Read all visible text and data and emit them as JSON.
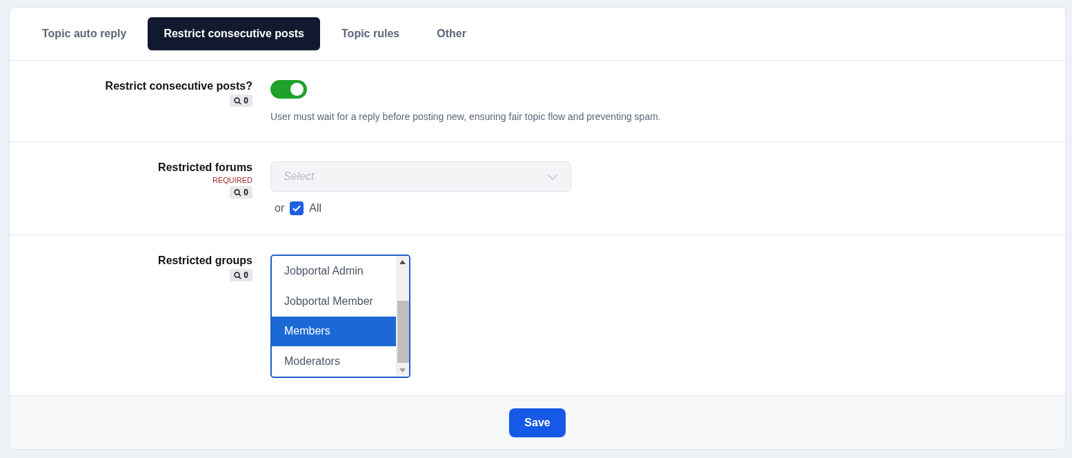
{
  "tabs": [
    {
      "label": "Topic auto reply",
      "selected": false
    },
    {
      "label": "Restrict consecutive posts",
      "selected": true
    },
    {
      "label": "Topic rules",
      "selected": false
    },
    {
      "label": "Other",
      "selected": false
    }
  ],
  "settings": [
    {
      "kind": "toggle",
      "label": "Restrict consecutive posts?",
      "required": false,
      "count": "0",
      "on": true,
      "help": "User must wait for a reply before posting new, ensuring fair topic flow and preventing spam."
    },
    {
      "kind": "select",
      "label": "Restricted forums",
      "required": true,
      "required_text": "REQUIRED",
      "count": "0",
      "placeholder": "Select",
      "disabled": true,
      "or_text": "or",
      "all_label": "All",
      "all_checked": true
    },
    {
      "kind": "listbox",
      "label": "Restricted groups",
      "required": false,
      "count": "0",
      "options": [
        {
          "label": "Jobportal Admin",
          "selected": false
        },
        {
          "label": "Jobportal Member",
          "selected": false
        },
        {
          "label": "Members",
          "selected": true
        },
        {
          "label": "Moderators",
          "selected": false
        }
      ]
    }
  ],
  "save_button": "Save"
}
